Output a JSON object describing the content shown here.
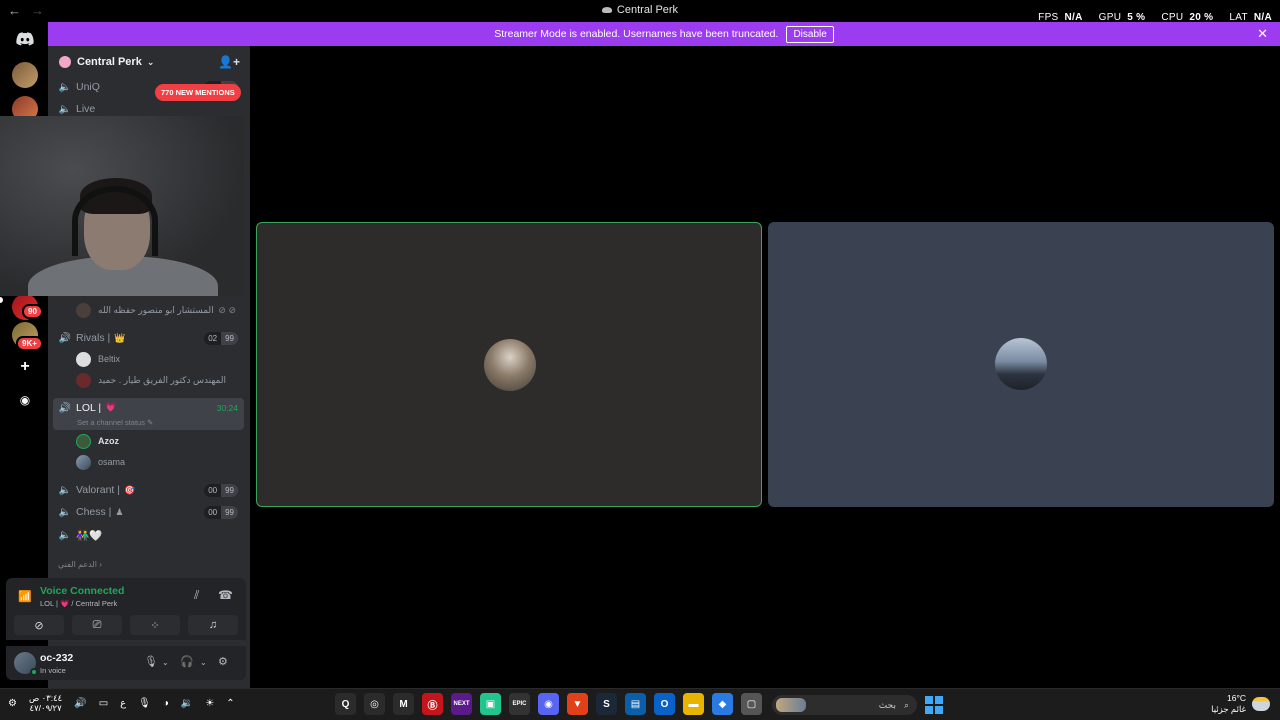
{
  "window": {
    "title": "Central Perk"
  },
  "perf": [
    {
      "k": "FPS",
      "v": "N/A"
    },
    {
      "k": "GPU",
      "v": "5 %"
    },
    {
      "k": "CPU",
      "v": "20 %"
    },
    {
      "k": "LAT",
      "v": "N/A"
    }
  ],
  "banner": {
    "text": "Streamer Mode is enabled. Usernames have been truncated.",
    "button": "Disable"
  },
  "rail": {
    "badge1": "90",
    "badge2": "9K+"
  },
  "server": {
    "name": "Central Perk"
  },
  "mentions": "770 NEW MENTIONS",
  "channels": {
    "uniq": {
      "name": "UniQ",
      "c1": "00",
      "c2": "20"
    },
    "live": {
      "name": "Live"
    },
    "rivals": {
      "name": "Rivals |",
      "emoji": "👑",
      "c1": "02",
      "c2": "99"
    },
    "lol": {
      "name": "LOL |",
      "emoji": "💗",
      "timer": "30:24",
      "status": "Set a channel status"
    },
    "valorant": {
      "name": "Valorant |",
      "emoji": "🎯",
      "c1": "00",
      "c2": "99"
    },
    "chess": {
      "name": "Chess |",
      "emoji": "♟",
      "c1": "00",
      "c2": "99"
    },
    "hearts": {
      "name": "👫🤍"
    }
  },
  "members": {
    "m0": "المستشار ابو منصور حفظه الله",
    "m1": "Beltix",
    "m2": "المهندس دكتور الفريق طيار . حميد",
    "m3": "Azoz",
    "m4": "osama"
  },
  "support": "الدعم الفني",
  "voice": {
    "status": "Voice Connected",
    "channel": "LOL | 💗 / Central Perk"
  },
  "user": {
    "name": "oc-232",
    "status": "In voice"
  },
  "taskbar": {
    "time": "٠٣:٤٤ ص",
    "date": "٤٧/٠٩/٢٧",
    "lang": "ع",
    "search": "بحث",
    "temp": "16°C",
    "weather": "غائم جزئيا",
    "apps": [
      "Q",
      "◎",
      "M",
      "Ⓑ",
      "NEXT",
      "▣",
      "EPIC",
      "◉",
      "▼",
      "S",
      "▤",
      "O",
      "▬",
      "◆",
      "▢"
    ],
    "colors": [
      "#2b2b2b",
      "#2b2b2b",
      "#2b2b2b",
      "#c4151c",
      "#5a1a8a",
      "#22c58e",
      "#333",
      "#5865f2",
      "#e0401a",
      "#1b2838",
      "#0b5ea8",
      "#0a62c9",
      "#e8b400",
      "#2a7be0",
      "#555"
    ]
  }
}
